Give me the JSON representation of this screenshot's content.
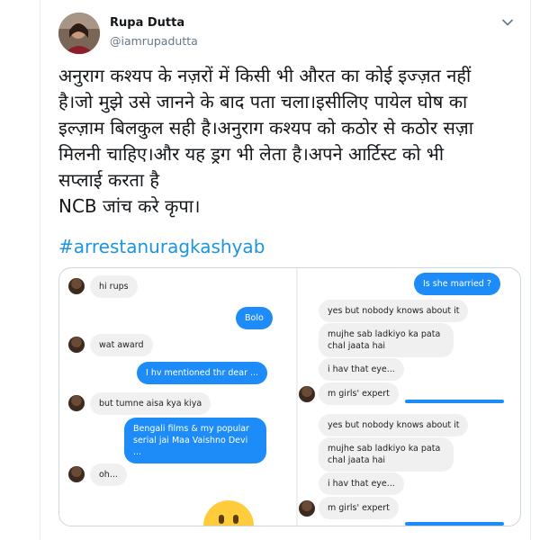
{
  "tweet": {
    "author_name": "Rupa Dutta",
    "author_handle": "@iamrupadutta",
    "text": "अनुराग कश्यप के नज़रों में किसी भी औरत का कोई इज्ज़त नहीं है।जो मुझे उसे जानने के बाद पता चला।इसीलिए पायेल घोष का इल्ज़ाम बिलकुल सही है।अनुराग कश्यप को कठोर से कठोर सज़ा मिलनी चाहिए।और यह ड्रग भी लेता है।अपने आर्टिस्ट को भी सप्लाई करता है\n NCB जांच करे कृपा।",
    "hashtag": "#arrestanuragkashyab"
  },
  "colors": {
    "link": "#1b95e0",
    "bubble_out": "#1d8cf8",
    "bubble_in": "#f1f0f0"
  },
  "chat_left": [
    {
      "text": "hi rups",
      "dir": "in"
    },
    {
      "text": "Bolo",
      "dir": "out"
    },
    {
      "text": "wat award",
      "dir": "in"
    },
    {
      "text": "I hv mentioned thr dear ...",
      "dir": "out"
    },
    {
      "text": "but tumne aisa kya kiya",
      "dir": "in"
    },
    {
      "text": "Bengali films & my popular serial jai Maa Vaishno Devi ...",
      "dir": "out"
    },
    {
      "text": "oh...",
      "dir": "in"
    }
  ],
  "chat_right": [
    {
      "text": "Is she married ?",
      "dir": "out"
    },
    {
      "text": "yes  but nobody knows about it",
      "dir": "in"
    },
    {
      "text": "mujhe sab ladkiyo ka pata chal jaata hai",
      "dir": "in"
    },
    {
      "text": "i hav that eye...",
      "dir": "in"
    },
    {
      "text": "m girls' expert",
      "dir": "in"
    },
    {
      "text": "yes  but nobody knows about it",
      "dir": "in"
    },
    {
      "text": "mujhe sab ladkiyo ka pata chal jaata hai",
      "dir": "in"
    },
    {
      "text": "i hav that eye...",
      "dir": "in"
    },
    {
      "text": "m girls' expert",
      "dir": "in"
    }
  ]
}
